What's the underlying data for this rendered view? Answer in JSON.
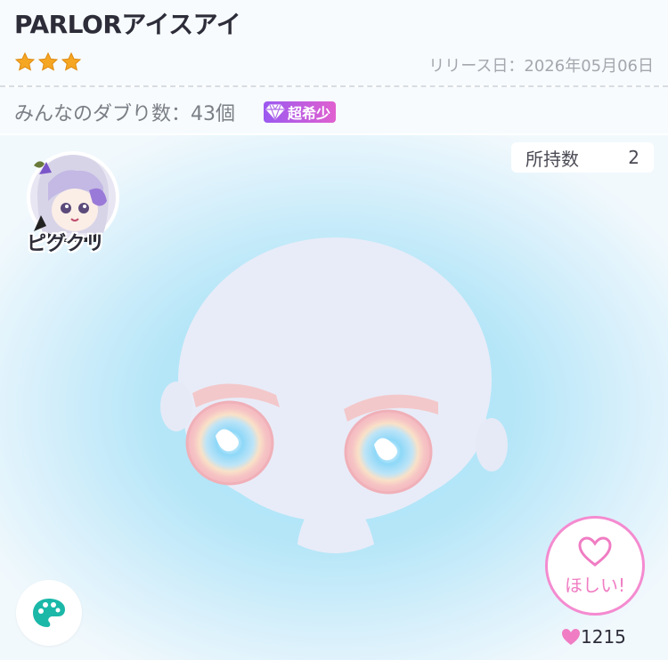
{
  "item": {
    "title": "PARLORアイスアイ",
    "star_count": 3,
    "release": "リリース日：2026年05月06日",
    "dup_text": "みんなのダブり数：43個",
    "rarity": "超希少",
    "owned_label": "所持数",
    "owned_count": "2",
    "creator_name": "ピグクリ"
  },
  "actions": {
    "want_label": "ほしい!",
    "like_count": "1215"
  },
  "colors": {
    "star": "#f5a623",
    "rarity_gradient": [
      "#9b59f0",
      "#e060d0"
    ],
    "want_pink": "#f48bd0",
    "palette_teal": "#1bb8a8",
    "stage_blue": "#a8e8fb"
  }
}
